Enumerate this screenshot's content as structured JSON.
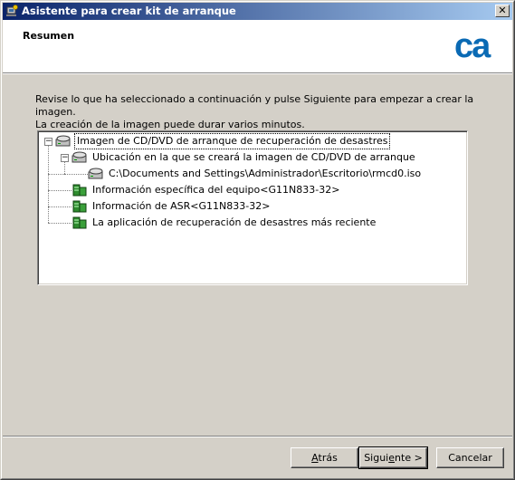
{
  "window": {
    "title": "Asistente para crear kit de arranque",
    "close_glyph": "✕"
  },
  "header": {
    "title": "Resumen",
    "logo_text": "ca"
  },
  "description": {
    "line1": "Revise lo que ha seleccionado a continuación y pulse Siguiente para empezar a crear la imagen.",
    "line2": "La creación de la imagen puede durar varios minutos."
  },
  "tree": {
    "root": {
      "label": "Imagen de CD/DVD de arranque de recuperación de desastres",
      "icon": "drive-icon",
      "expanded": true,
      "selected": true
    },
    "location": {
      "label": "Ubicación en la que se creará la imagen de CD/DVD de arranque",
      "icon": "drive-icon",
      "expanded": true
    },
    "path": {
      "label": "C:\\Documents and Settings\\Administrador\\Escritorio\\rmcd0.iso",
      "icon": "drive-icon"
    },
    "machine_info": {
      "label": "Información específica del equipo<G11N833-32>",
      "icon": "server-icon"
    },
    "asr_info": {
      "label": "Información de ASR<G11N833-32>",
      "icon": "server-icon"
    },
    "latest_app": {
      "label": "La aplicación de recuperación de desastres más reciente",
      "icon": "server-icon"
    }
  },
  "buttons": {
    "back": {
      "mnemonic": "A",
      "rest": "trás"
    },
    "next": {
      "prefix": "Sigui",
      "mnemonic": "e",
      "rest": "nte >"
    },
    "cancel": "Cancelar"
  },
  "colors": {
    "title_start": "#0a246a",
    "title_end": "#a6caf0",
    "logo_blue": "#0a6ab4",
    "face": "#d4d0c8"
  }
}
